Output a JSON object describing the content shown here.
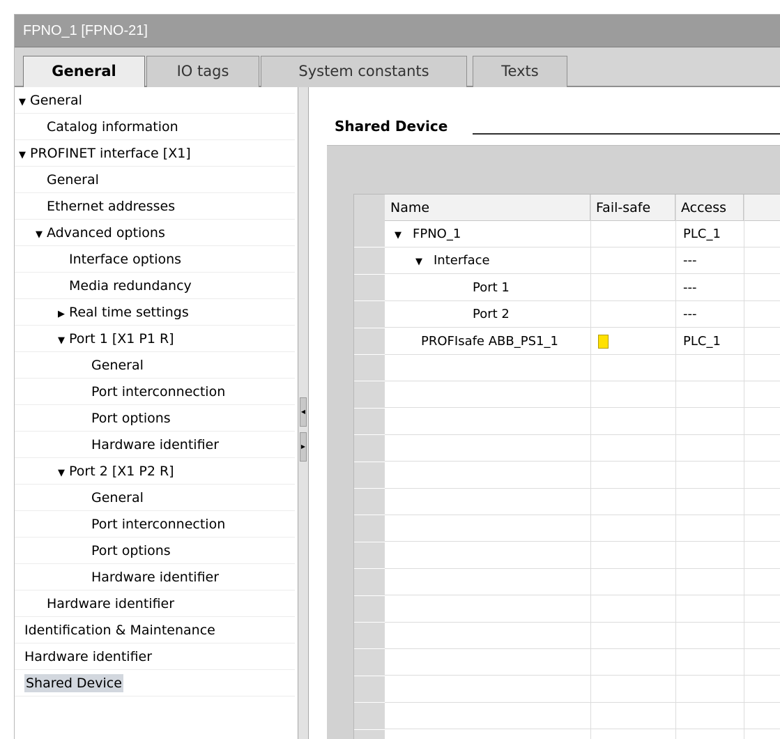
{
  "window": {
    "title": "FPNO_1 [FPNO-21]"
  },
  "tabs": [
    {
      "label": "General",
      "active": true
    },
    {
      "label": "IO tags",
      "active": false
    },
    {
      "label": "System constants",
      "active": false
    },
    {
      "label": "Texts",
      "active": false
    }
  ],
  "nav": [
    {
      "label": "General",
      "expanded": true,
      "level": 0
    },
    {
      "label": "Catalog information",
      "level": 1
    },
    {
      "label": "PROFINET interface [X1]",
      "expanded": true,
      "level": 0
    },
    {
      "label": "General",
      "level": 1
    },
    {
      "label": "Ethernet addresses",
      "level": 1
    },
    {
      "label": "Advanced options",
      "expanded": true,
      "level": 1
    },
    {
      "label": "Interface options",
      "level": 2
    },
    {
      "label": "Media redundancy",
      "level": 2
    },
    {
      "label": "Real time settings",
      "expanded": false,
      "level": 2
    },
    {
      "label": "Port 1 [X1 P1 R]",
      "expanded": true,
      "level": 2
    },
    {
      "label": "General",
      "level": 3
    },
    {
      "label": "Port interconnection",
      "level": 3
    },
    {
      "label": "Port options",
      "level": 3
    },
    {
      "label": "Hardware identifier",
      "level": 3
    },
    {
      "label": "Port 2 [X1 P2 R]",
      "expanded": true,
      "level": 2
    },
    {
      "label": "General",
      "level": 3
    },
    {
      "label": "Port interconnection",
      "level": 3
    },
    {
      "label": "Port options",
      "level": 3
    },
    {
      "label": "Hardware identifier",
      "level": 3
    },
    {
      "label": "Hardware identifier",
      "level": 1
    },
    {
      "label": "Identification & Maintenance",
      "level": 0
    },
    {
      "label": "Hardware identifier",
      "level": 0
    },
    {
      "label": "Shared Device",
      "level": 0,
      "selected": true
    }
  ],
  "section": {
    "title": "Shared Device"
  },
  "table": {
    "columns": [
      "Name",
      "Fail-safe",
      "Access"
    ],
    "rows": [
      {
        "name": "FPNO_1",
        "expanded": true,
        "level": 0,
        "fail_safe": false,
        "access": "PLC_1"
      },
      {
        "name": "Interface",
        "expanded": true,
        "level": 1,
        "fail_safe": false,
        "access": "---"
      },
      {
        "name": "Port 1",
        "level": 2,
        "fail_safe": false,
        "access": "---"
      },
      {
        "name": "Port 2",
        "level": 2,
        "fail_safe": false,
        "access": "---"
      },
      {
        "name": "PROFIsafe ABB_PS1_1",
        "level": 0,
        "fail_safe": true,
        "access": "PLC_1"
      }
    ]
  },
  "colors": {
    "fail_safe_marker": "#ffe100",
    "selected_nav": "#d2d7de",
    "titlebar": "#9c9c9c"
  }
}
